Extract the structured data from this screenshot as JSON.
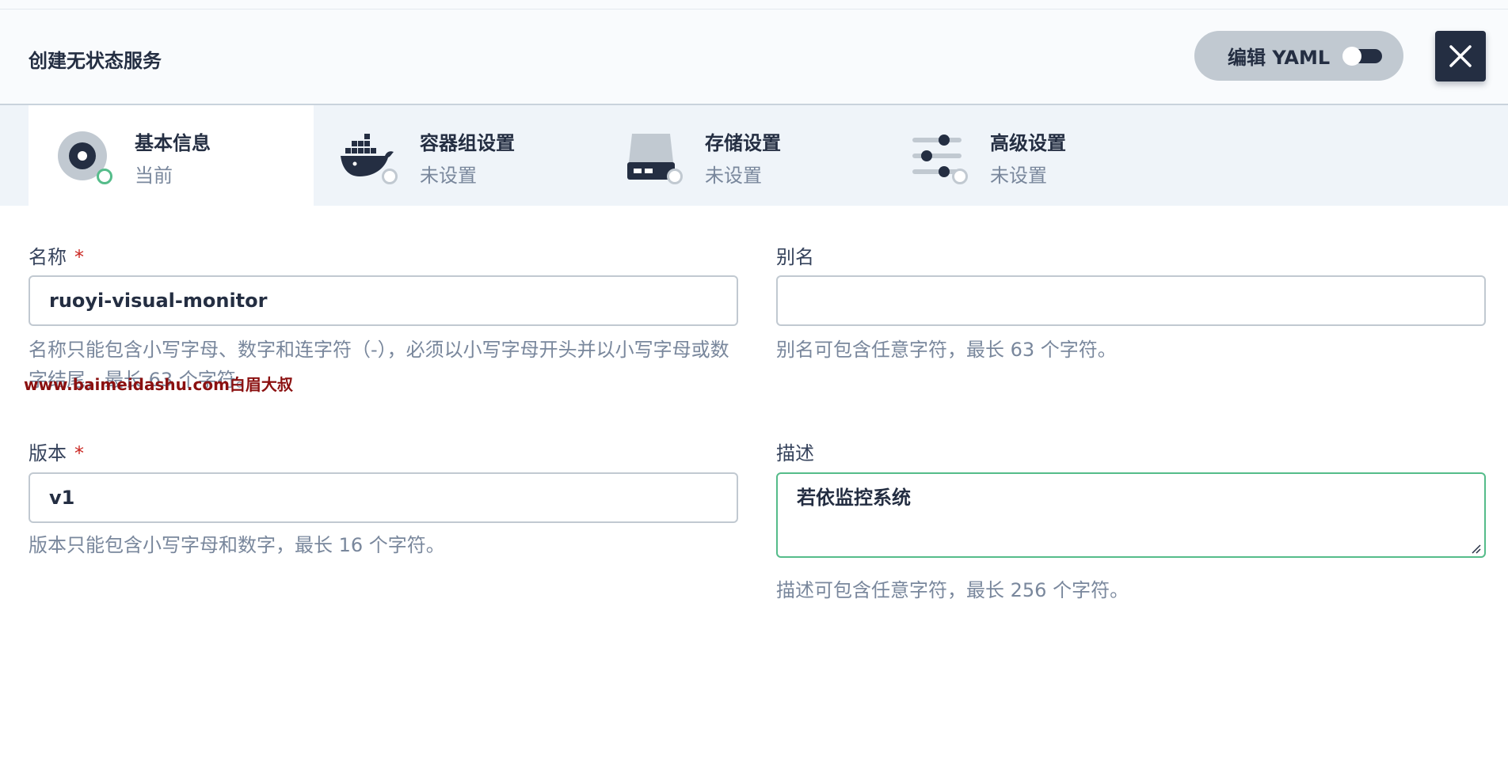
{
  "header": {
    "title": "创建无状态服务",
    "yaml_label": "编辑 YAML"
  },
  "steps": [
    {
      "name": "基本信息",
      "status": "当前",
      "icon": "disk-icon",
      "active": true
    },
    {
      "name": "容器组设置",
      "status": "未设置",
      "icon": "docker-whale-icon",
      "active": false
    },
    {
      "name": "存储设置",
      "status": "未设置",
      "icon": "storage-drive-icon",
      "active": false
    },
    {
      "name": "高级设置",
      "status": "未设置",
      "icon": "sliders-icon",
      "active": false
    }
  ],
  "form": {
    "name": {
      "label": "名称",
      "required": "*",
      "value": "ruoyi-visual-monitor",
      "hint": "名称只能包含小写字母、数字和连字符（-），必须以小写字母开头并以小写字母或数字结尾，最长 63 个字符。"
    },
    "alias": {
      "label": "别名",
      "value": "",
      "hint": "别名可包含任意字符，最长 63 个字符。"
    },
    "version": {
      "label": "版本",
      "required": "*",
      "value": "v1",
      "hint": "版本只能包含小写字母和数字，最长 16 个字符。"
    },
    "description": {
      "label": "描述",
      "value": "若依监控系统",
      "hint": "描述可包含任意字符，最长 256 个字符。"
    }
  },
  "watermark": "www.baimeidashu.com白眉大叔",
  "colors": {
    "primary": "#242e42",
    "accent_green": "#55bc8a",
    "required_red": "#ca2621",
    "muted_text": "#79879c",
    "border": "#c1c9d1"
  }
}
